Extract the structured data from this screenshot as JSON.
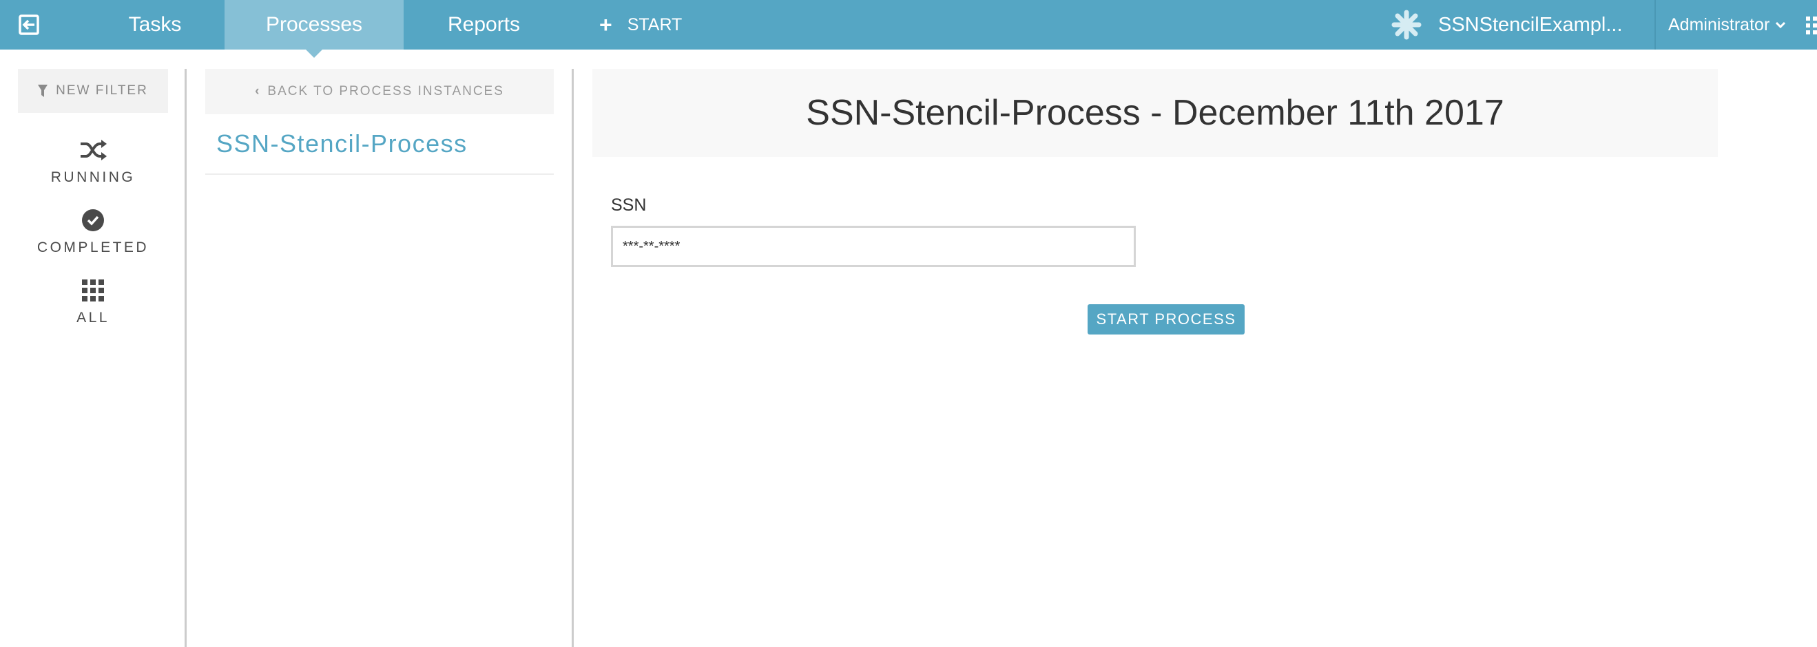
{
  "topbar": {
    "back_icon": "exit-to-left-icon",
    "nav": {
      "tasks": "Tasks",
      "processes": "Processes",
      "reports": "Reports",
      "start": "START"
    },
    "active_tab": "Processes",
    "app_name": "SSNStencilExampl...",
    "app_icon": "asterisk-icon",
    "user": "Administrator",
    "apps_icon": "grid-icon"
  },
  "filters": {
    "new_filter": "NEW FILTER",
    "running": "RUNNING",
    "completed": "COMPLETED",
    "all": "ALL"
  },
  "middle": {
    "back_label": "BACK TO PROCESS INSTANCES",
    "items": [
      {
        "label": "SSN-Stencil-Process"
      }
    ]
  },
  "detail": {
    "title": "SSN-Stencil-Process - December 11th 2017",
    "form": {
      "ssn_label": "SSN",
      "ssn_value": "***-**-****"
    },
    "start_button": "START PROCESS"
  },
  "colors": {
    "brand": "#55a6c4",
    "active_tab": "#86c0d6",
    "text": "#333333"
  }
}
